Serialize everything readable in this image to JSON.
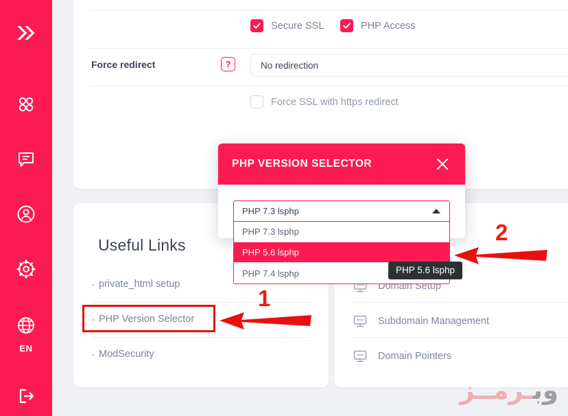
{
  "sidebar": {
    "logo_icon": "double-chevron-logo",
    "items": [
      {
        "icon": "grid-apps-icon",
        "name": "apps"
      },
      {
        "icon": "chat-bubble-icon",
        "name": "messages"
      },
      {
        "icon": "user-circle-icon",
        "name": "account"
      },
      {
        "icon": "gear-icon",
        "name": "settings"
      },
      {
        "icon": "globe-icon",
        "name": "language"
      }
    ],
    "language_label": "EN",
    "logout_icon": "logout-icon"
  },
  "settings_panel": {
    "checkboxes": [
      {
        "label": "Secure SSL",
        "checked": true
      },
      {
        "label": "PHP Access",
        "checked": true
      }
    ],
    "force_redirect": {
      "label": "Force redirect",
      "help_badge": "?",
      "value": "No redirection"
    },
    "force_ssl": {
      "label": "Force SSL with https redirect",
      "checked": false
    }
  },
  "useful_links": {
    "title": "Useful Links",
    "items": [
      {
        "label": "private_html setup"
      },
      {
        "label": "PHP Version Selector"
      },
      {
        "label": "ModSecurity"
      }
    ]
  },
  "domain_menu": {
    "items": [
      {
        "label": "Domain Setup",
        "icon": "monitor-icon"
      },
      {
        "label": "Subdomain Management",
        "icon": "monitor-icon"
      },
      {
        "label": "Domain Pointers",
        "icon": "monitor-icon"
      }
    ]
  },
  "modal": {
    "title": "PHP VERSION SELECTOR",
    "close_icon": "close-icon"
  },
  "dropdown": {
    "selected_value": "PHP 7.3 lsphp",
    "caret_icon": "chevron-up-icon",
    "options": [
      {
        "label": "PHP 7.3 lsphp",
        "highlighted": false
      },
      {
        "label": "PHP 5.6 lsphp",
        "highlighted": true
      },
      {
        "label": "PHP 7.4 lsphp",
        "highlighted": false
      }
    ]
  },
  "tooltip": {
    "text": "PHP 5.6 lsphp"
  },
  "annotations": [
    {
      "number": "1"
    },
    {
      "number": "2"
    }
  ],
  "watermark": {
    "part_gray": "وب",
    "part_pink": "ـرمــز"
  },
  "colors": {
    "accent": "#fb1b52",
    "annotation_red": "#e8110f",
    "page_bg": "#eff1f5",
    "card_bg": "#ffffff",
    "text_muted": "#7c85a0",
    "tooltip_bg": "#2e3134"
  }
}
